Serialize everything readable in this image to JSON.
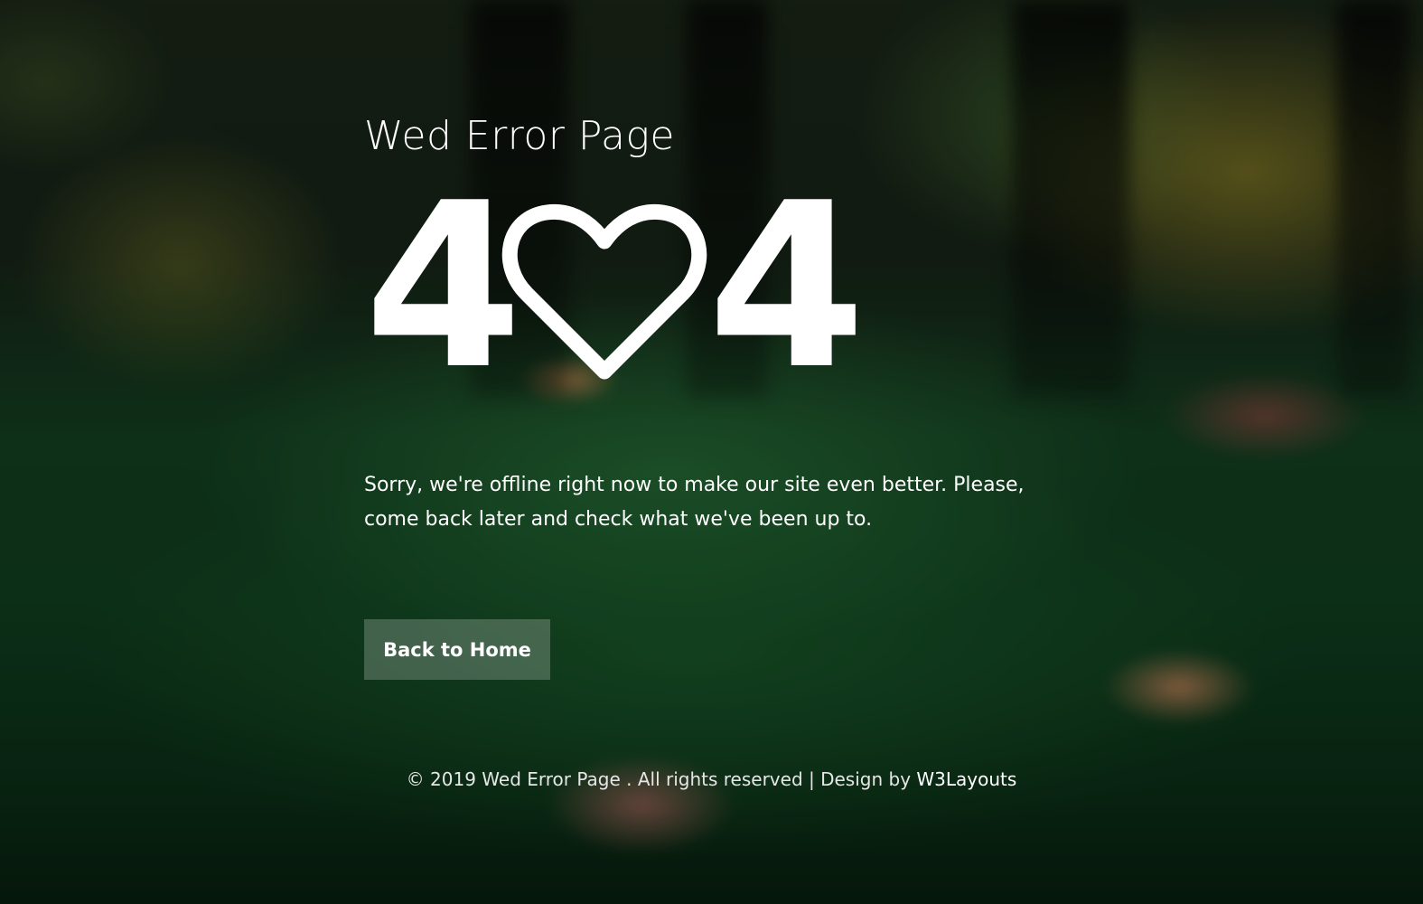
{
  "header": {
    "title": "Wed Error Page"
  },
  "error": {
    "digit_left": "4",
    "digit_right": "4",
    "middle_icon": "heart-outline-icon"
  },
  "message": {
    "text": "Sorry, we're offline right now to make our site even better. Please, come back later and check what we've been up to."
  },
  "actions": {
    "home_label": "Back to Home"
  },
  "footer": {
    "copyright": "© 2019 Wed Error Page . All rights reserved | Design by ",
    "design_link": "W3Layouts"
  },
  "colors": {
    "text": "#ffffff",
    "button_bg": "rgba(255,255,255,0.22)"
  }
}
